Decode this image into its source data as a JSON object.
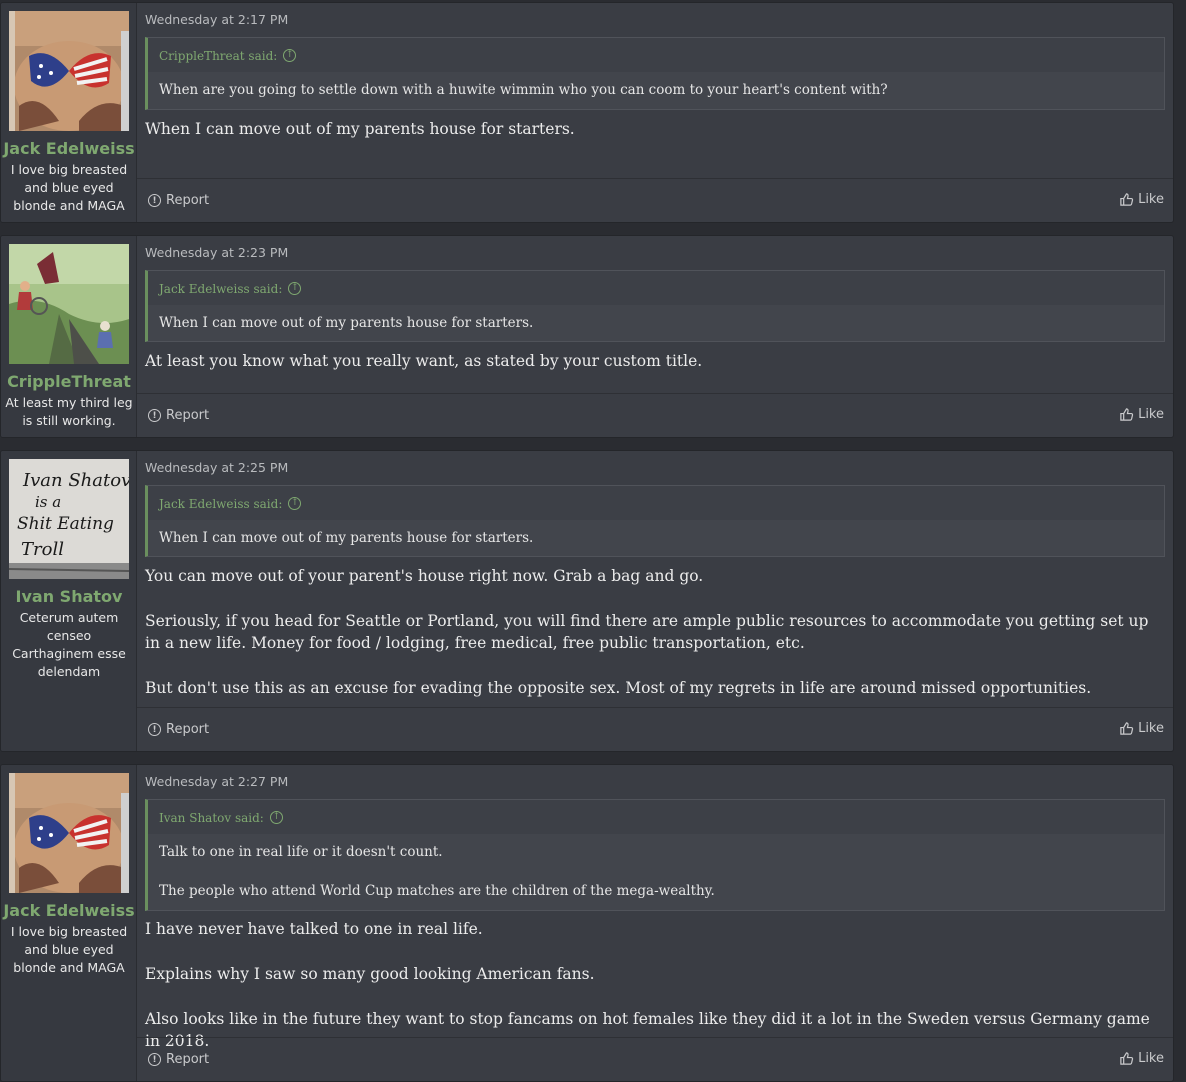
{
  "report_label": "Report",
  "like_label": "Like",
  "said_suffix": "said:",
  "posts": [
    {
      "user": {
        "name": "Jack Edelweiss",
        "title": "I love big breasted and blue eyed blonde and MAGA",
        "avatar": "flag-bikini-avatar"
      },
      "date": "Wednesday at 2:17 PM",
      "quote": {
        "author": "CrippleThreat said:",
        "lines": [
          "When are you going to settle down with a huwite wimmin who you can coom to your heart's content with?"
        ]
      },
      "body": [
        "When I can move out of my parents house for starters."
      ]
    },
    {
      "user": {
        "name": "CrippleThreat",
        "title": "At least my third leg is still working.",
        "avatar": "cliff-cartoon-avatar"
      },
      "date": "Wednesday at 2:23 PM",
      "quote": {
        "author": "Jack Edelweiss said:",
        "lines": [
          "When I can move out of my parents house for starters."
        ]
      },
      "body": [
        "At least you know what you really want, as stated by your custom title."
      ]
    },
    {
      "user": {
        "name": "Ivan Shatov",
        "title": "Ceterum autem censeo Carthaginem esse delendam",
        "avatar": "handwritten-sign-avatar"
      },
      "date": "Wednesday at 2:25 PM",
      "quote": {
        "author": "Jack Edelweiss said:",
        "lines": [
          "When I can move out of my parents house for starters."
        ]
      },
      "body": [
        "You can move out of your parent's house right now. Grab a bag and go.",
        "Seriously, if you head for Seattle or Portland, you will find there are ample public resources to accommodate you getting set up in a new life. Money for food / lodging, free medical, free public transportation, etc.",
        "But don't use this as an excuse for evading the opposite sex. Most of my regrets in life are around missed opportunities."
      ]
    },
    {
      "user": {
        "name": "Jack Edelweiss",
        "title": "I love big breasted and blue eyed blonde and MAGA",
        "avatar": "flag-bikini-avatar"
      },
      "date": "Wednesday at 2:27 PM",
      "quote": {
        "author": "Ivan Shatov said:",
        "lines": [
          "Talk to one in real life or it doesn't count.",
          "The people who attend World Cup matches are the children of the mega-wealthy."
        ]
      },
      "body": [
        "I have never have talked to one in real life.",
        "Explains why I saw so many good looking American fans.",
        "Also looks like in the future they want to stop fancams on hot females like they did it a lot in the Sweden versus Germany game in 2018."
      ]
    }
  ],
  "sign_text": [
    "Ivan Shatov",
    "is a",
    "Shit Eating",
    "Troll"
  ]
}
